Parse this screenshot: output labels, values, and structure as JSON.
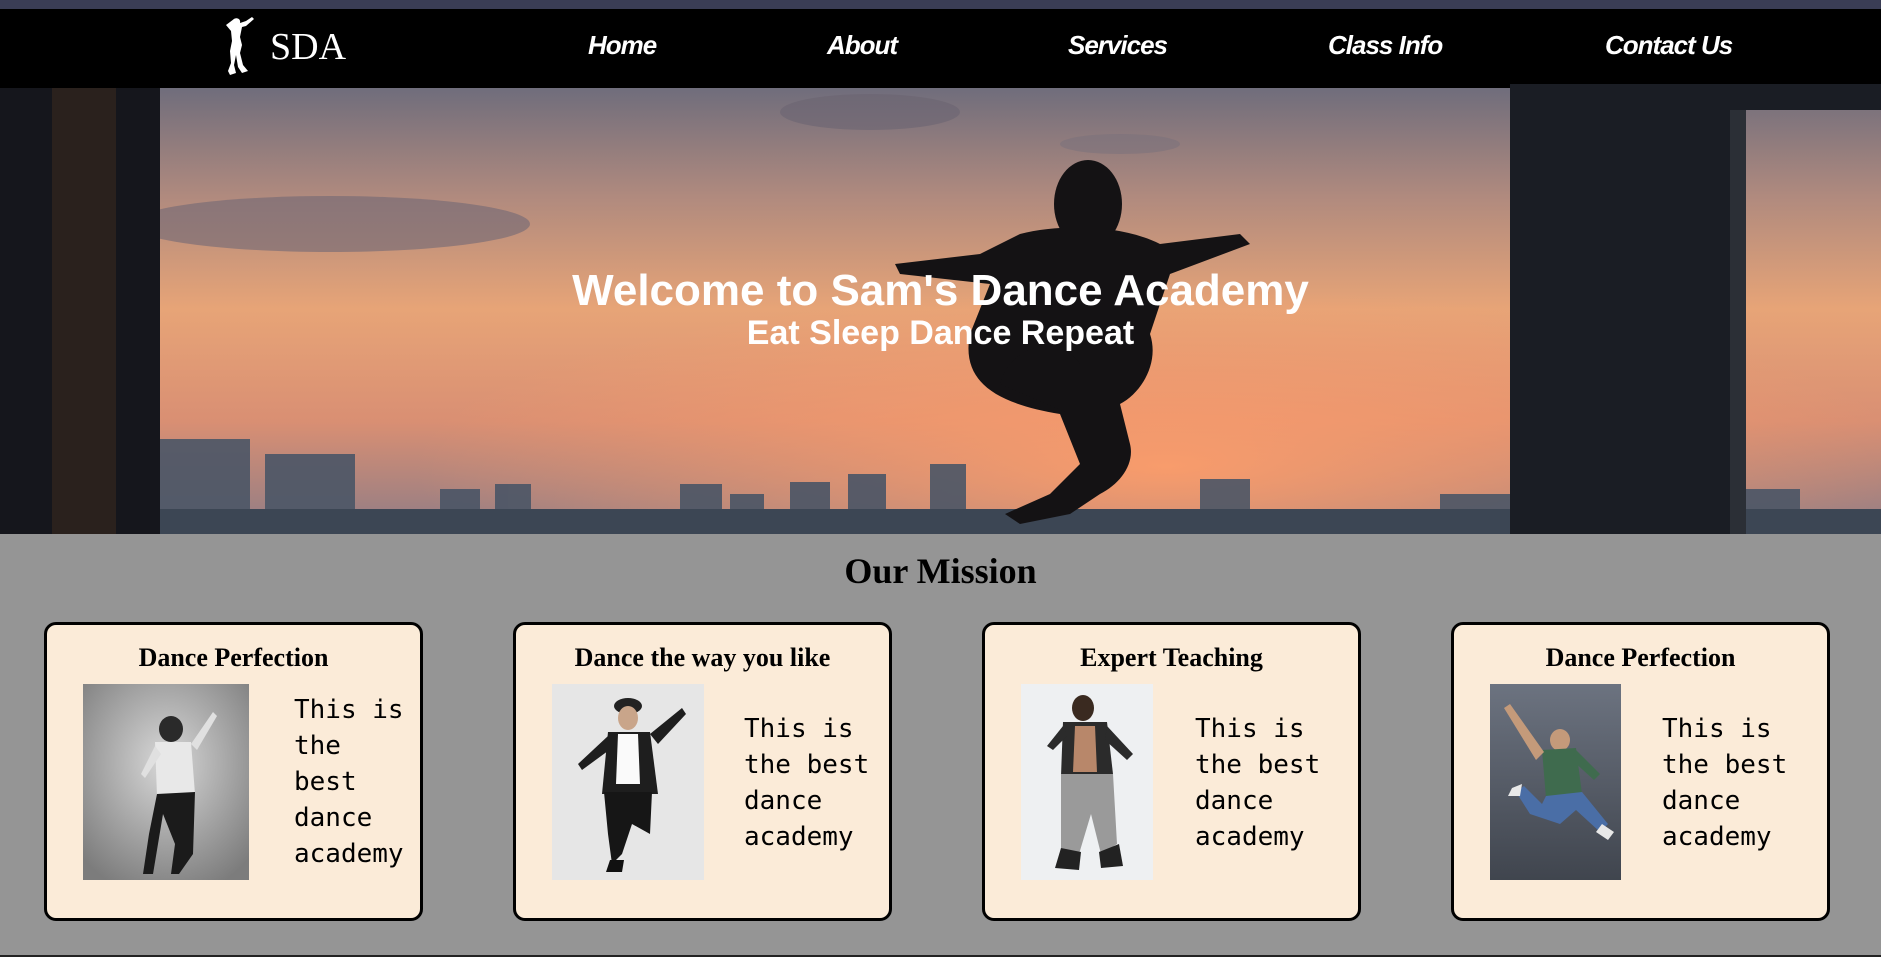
{
  "brand": {
    "logo_icon": "dancer-silhouette-icon",
    "name": "SDA"
  },
  "nav": {
    "items": [
      {
        "label": "Home"
      },
      {
        "label": "About"
      },
      {
        "label": "Services"
      },
      {
        "label": "Class Info"
      },
      {
        "label": "Contact Us"
      }
    ]
  },
  "hero": {
    "title": "Welcome to Sam's Dance Academy",
    "subtitle": "Eat Sleep Dance Repeat"
  },
  "mission": {
    "title": "Our Mission",
    "cards": [
      {
        "title": "Dance Perfection",
        "text": "This is the best dance academy",
        "image": "dancer-in-hat-photo"
      },
      {
        "title": "Dance the way you like",
        "text": "This is the best dance academy",
        "image": "dancer-jumping-photo"
      },
      {
        "title": "Expert Teaching",
        "text": "This is the best dance academy",
        "image": "hiphop-dancer-photo"
      },
      {
        "title": "Dance Perfection",
        "text": "This is the best dance academy",
        "image": "dancer-leaping-photo"
      }
    ]
  },
  "colors": {
    "navbar_bg": "#000000",
    "card_bg": "#fbebd8",
    "section_bg": "#959595",
    "text_light": "#ffffff"
  }
}
